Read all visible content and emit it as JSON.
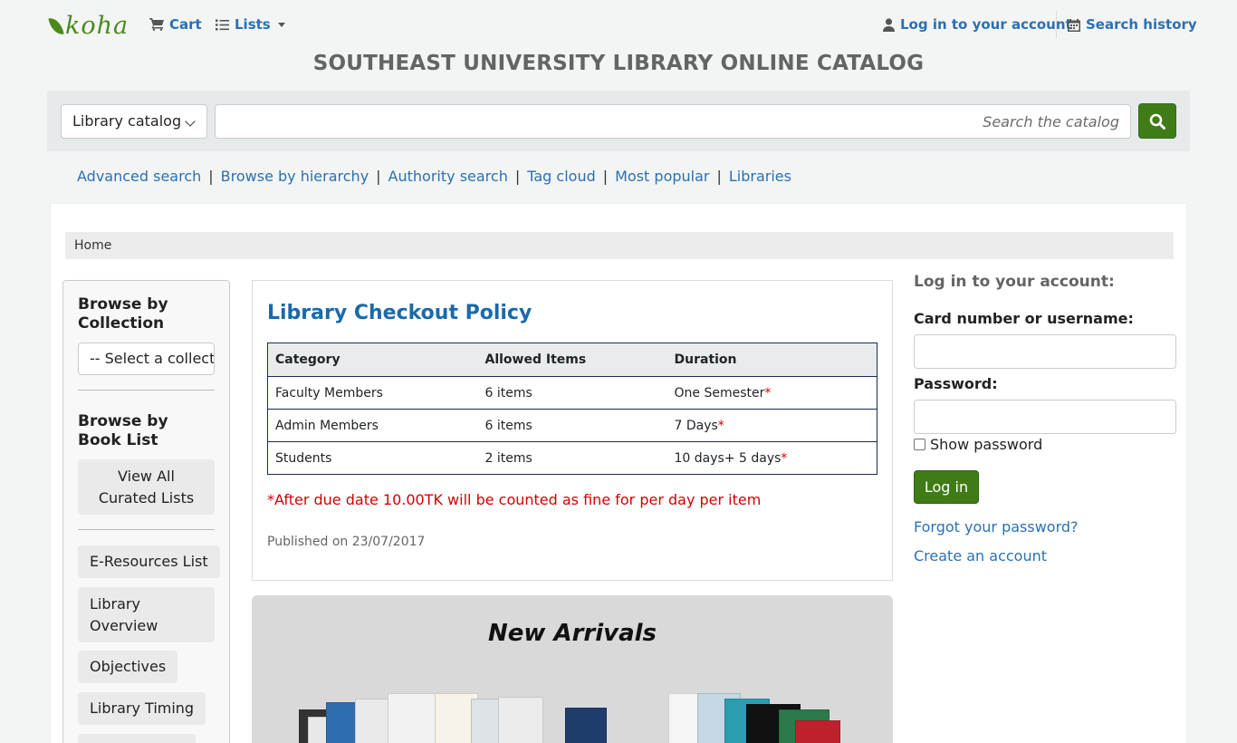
{
  "header": {
    "logo_text": "koha",
    "cart_label": "Cart",
    "lists_label": "Lists",
    "login_label": "Log in to your account",
    "search_history_label": "Search history",
    "site_title": "SOUTHEAST UNIVERSITY LIBRARY ONLINE CATALOG"
  },
  "search": {
    "scope_selected": "Library catalog",
    "placeholder": "Search the catalog"
  },
  "quick_links": [
    "Advanced search",
    "Browse by hierarchy",
    "Authority search",
    "Tag cloud",
    "Most popular",
    "Libraries"
  ],
  "breadcrumb": "Home",
  "sidebar": {
    "collection_heading": "Browse by Collection",
    "collection_select": "-- Select a collect",
    "booklist_heading": "Browse by Book List",
    "view_all_lists": "View All Curated Lists",
    "items": [
      "E-Resources List",
      "Library Overview",
      "Objectives",
      "Library Timing"
    ]
  },
  "policy": {
    "title": "Library Checkout Policy",
    "columns": [
      "Category",
      "Allowed Items",
      "Duration"
    ],
    "rows": [
      [
        "Faculty Members",
        "6 items",
        "One Semester",
        "*"
      ],
      [
        "Admin Members",
        "6 items",
        "7 Days",
        "*"
      ],
      [
        "Students",
        "2 items",
        "10 days+ 5 days",
        "*"
      ]
    ],
    "fine_note": "*After due date 10.00TK will be counted as fine for per day per item",
    "published": "Published on 23/07/2017"
  },
  "arrivals": {
    "title": "New Arrivals"
  },
  "login": {
    "heading": "Log in to your account:",
    "username_label": "Card number or username:",
    "password_label": "Password:",
    "show_password": "Show password",
    "login_button": "Log in",
    "forgot": "Forgot your password?",
    "create": "Create an account"
  },
  "colors": {
    "brand_green": "#3f7c17",
    "link_blue": "#2a71b3",
    "alert_red": "#d40000"
  }
}
